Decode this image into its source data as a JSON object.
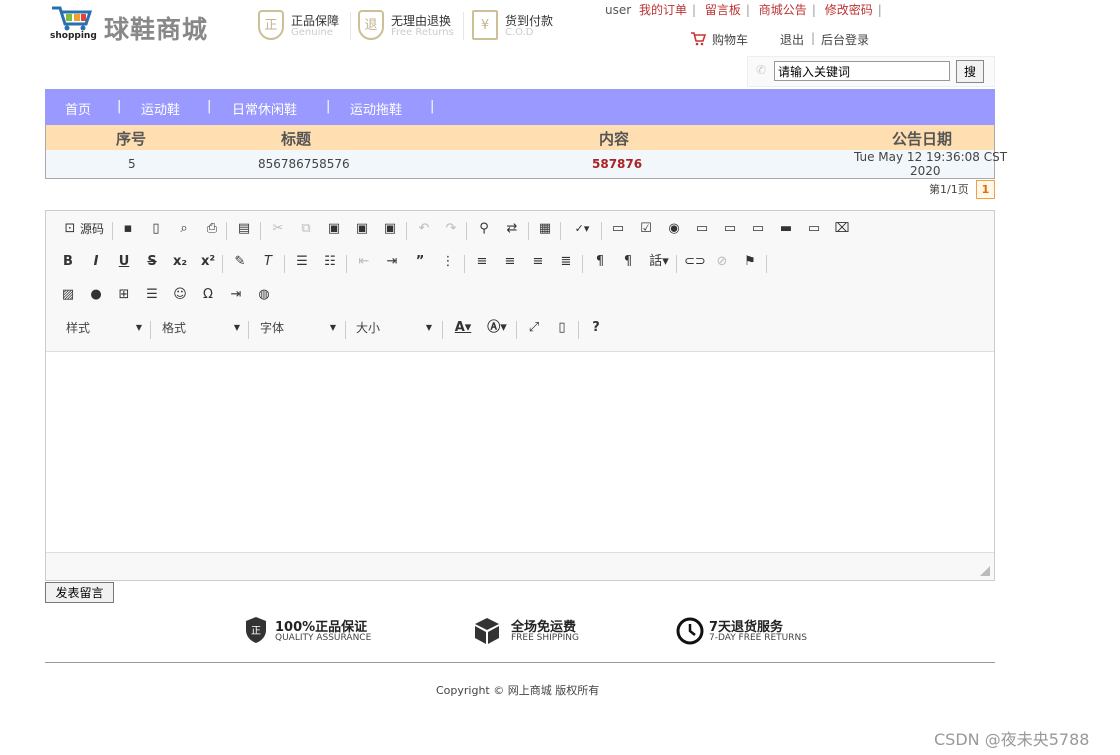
{
  "header": {
    "logo_word": "shopping",
    "site_name": "球鞋商城",
    "badges": [
      {
        "icon": "正",
        "title": "正品保障",
        "subtitle": "Genuine"
      },
      {
        "icon": "退",
        "title": "无理由退换",
        "subtitle": "Free Returns"
      },
      {
        "icon": "¥",
        "title": "货到付款",
        "subtitle": "C.O.D"
      }
    ],
    "user": "user",
    "top_links": [
      "我的订单",
      "留言板",
      "商城公告",
      "修改密码"
    ],
    "cart": "购物车",
    "logout": "退出",
    "admin_login": "后台登录",
    "search_value": "请输入关键词",
    "search_button": "搜"
  },
  "nav": {
    "items": [
      "首页",
      "运动鞋",
      "日常休闲鞋",
      "运动拖鞋"
    ]
  },
  "table": {
    "headers": [
      "序号",
      "标题",
      "内容",
      "公告日期"
    ],
    "rows": [
      {
        "id": "5",
        "title": "856786758576",
        "content": "587876",
        "date_line1": "Tue May 12 19:36:08 CST",
        "date_line2": "2020"
      }
    ]
  },
  "pager": {
    "text": "第1/1页",
    "current": "1"
  },
  "editor": {
    "source_label": "源码",
    "style_combo": "样式",
    "format_combo": "格式",
    "font_combo": "字体",
    "size_combo": "大小"
  },
  "submit_label": "发表留言",
  "footer": {
    "features": [
      {
        "icon": "shield-icon",
        "title": "100%正品保证",
        "subtitle": "QUALITY ASSURANCE"
      },
      {
        "icon": "box-icon",
        "title": "全场免运费",
        "subtitle": "FREE SHIPPING"
      },
      {
        "icon": "clock-icon",
        "title": "7天退货服务",
        "subtitle": "7-DAY FREE RETURNS"
      }
    ],
    "copyright": "Copyright © 网上商城 版权所有"
  },
  "watermark": "CSDN @夜未央5788",
  "colors": {
    "nav_bg": "#9999ff",
    "table_header_bg": "#ffdfb2",
    "link_red": "#b33333",
    "content_red": "#aa2222"
  }
}
